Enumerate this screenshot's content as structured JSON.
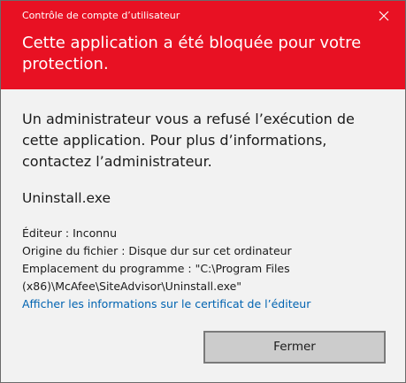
{
  "window": {
    "title": "Contrôle de compte d’utilisateur",
    "accent_color": "#e81123",
    "close_icon": "close-icon"
  },
  "header": {
    "headline": "Cette application a été bloquée pour votre protection."
  },
  "main": {
    "message": "Un administrateur vous a refusé l’exécution de cette application. Pour plus d’informations, contactez l’administrateur.",
    "filename": "Uninstall.exe",
    "publisher": "Éditeur : Inconnu",
    "origin": "Origine du fichier : Disque dur sur cet ordinateur",
    "location": "Emplacement du programme : \"C:\\Program Files (x86)\\McAfee\\SiteAdvisor\\Uninstall.exe\"",
    "cert_link": "Afficher les informations sur le certificat de l’éditeur",
    "link_color": "#0063b1"
  },
  "footer": {
    "close_button": "Fermer"
  }
}
